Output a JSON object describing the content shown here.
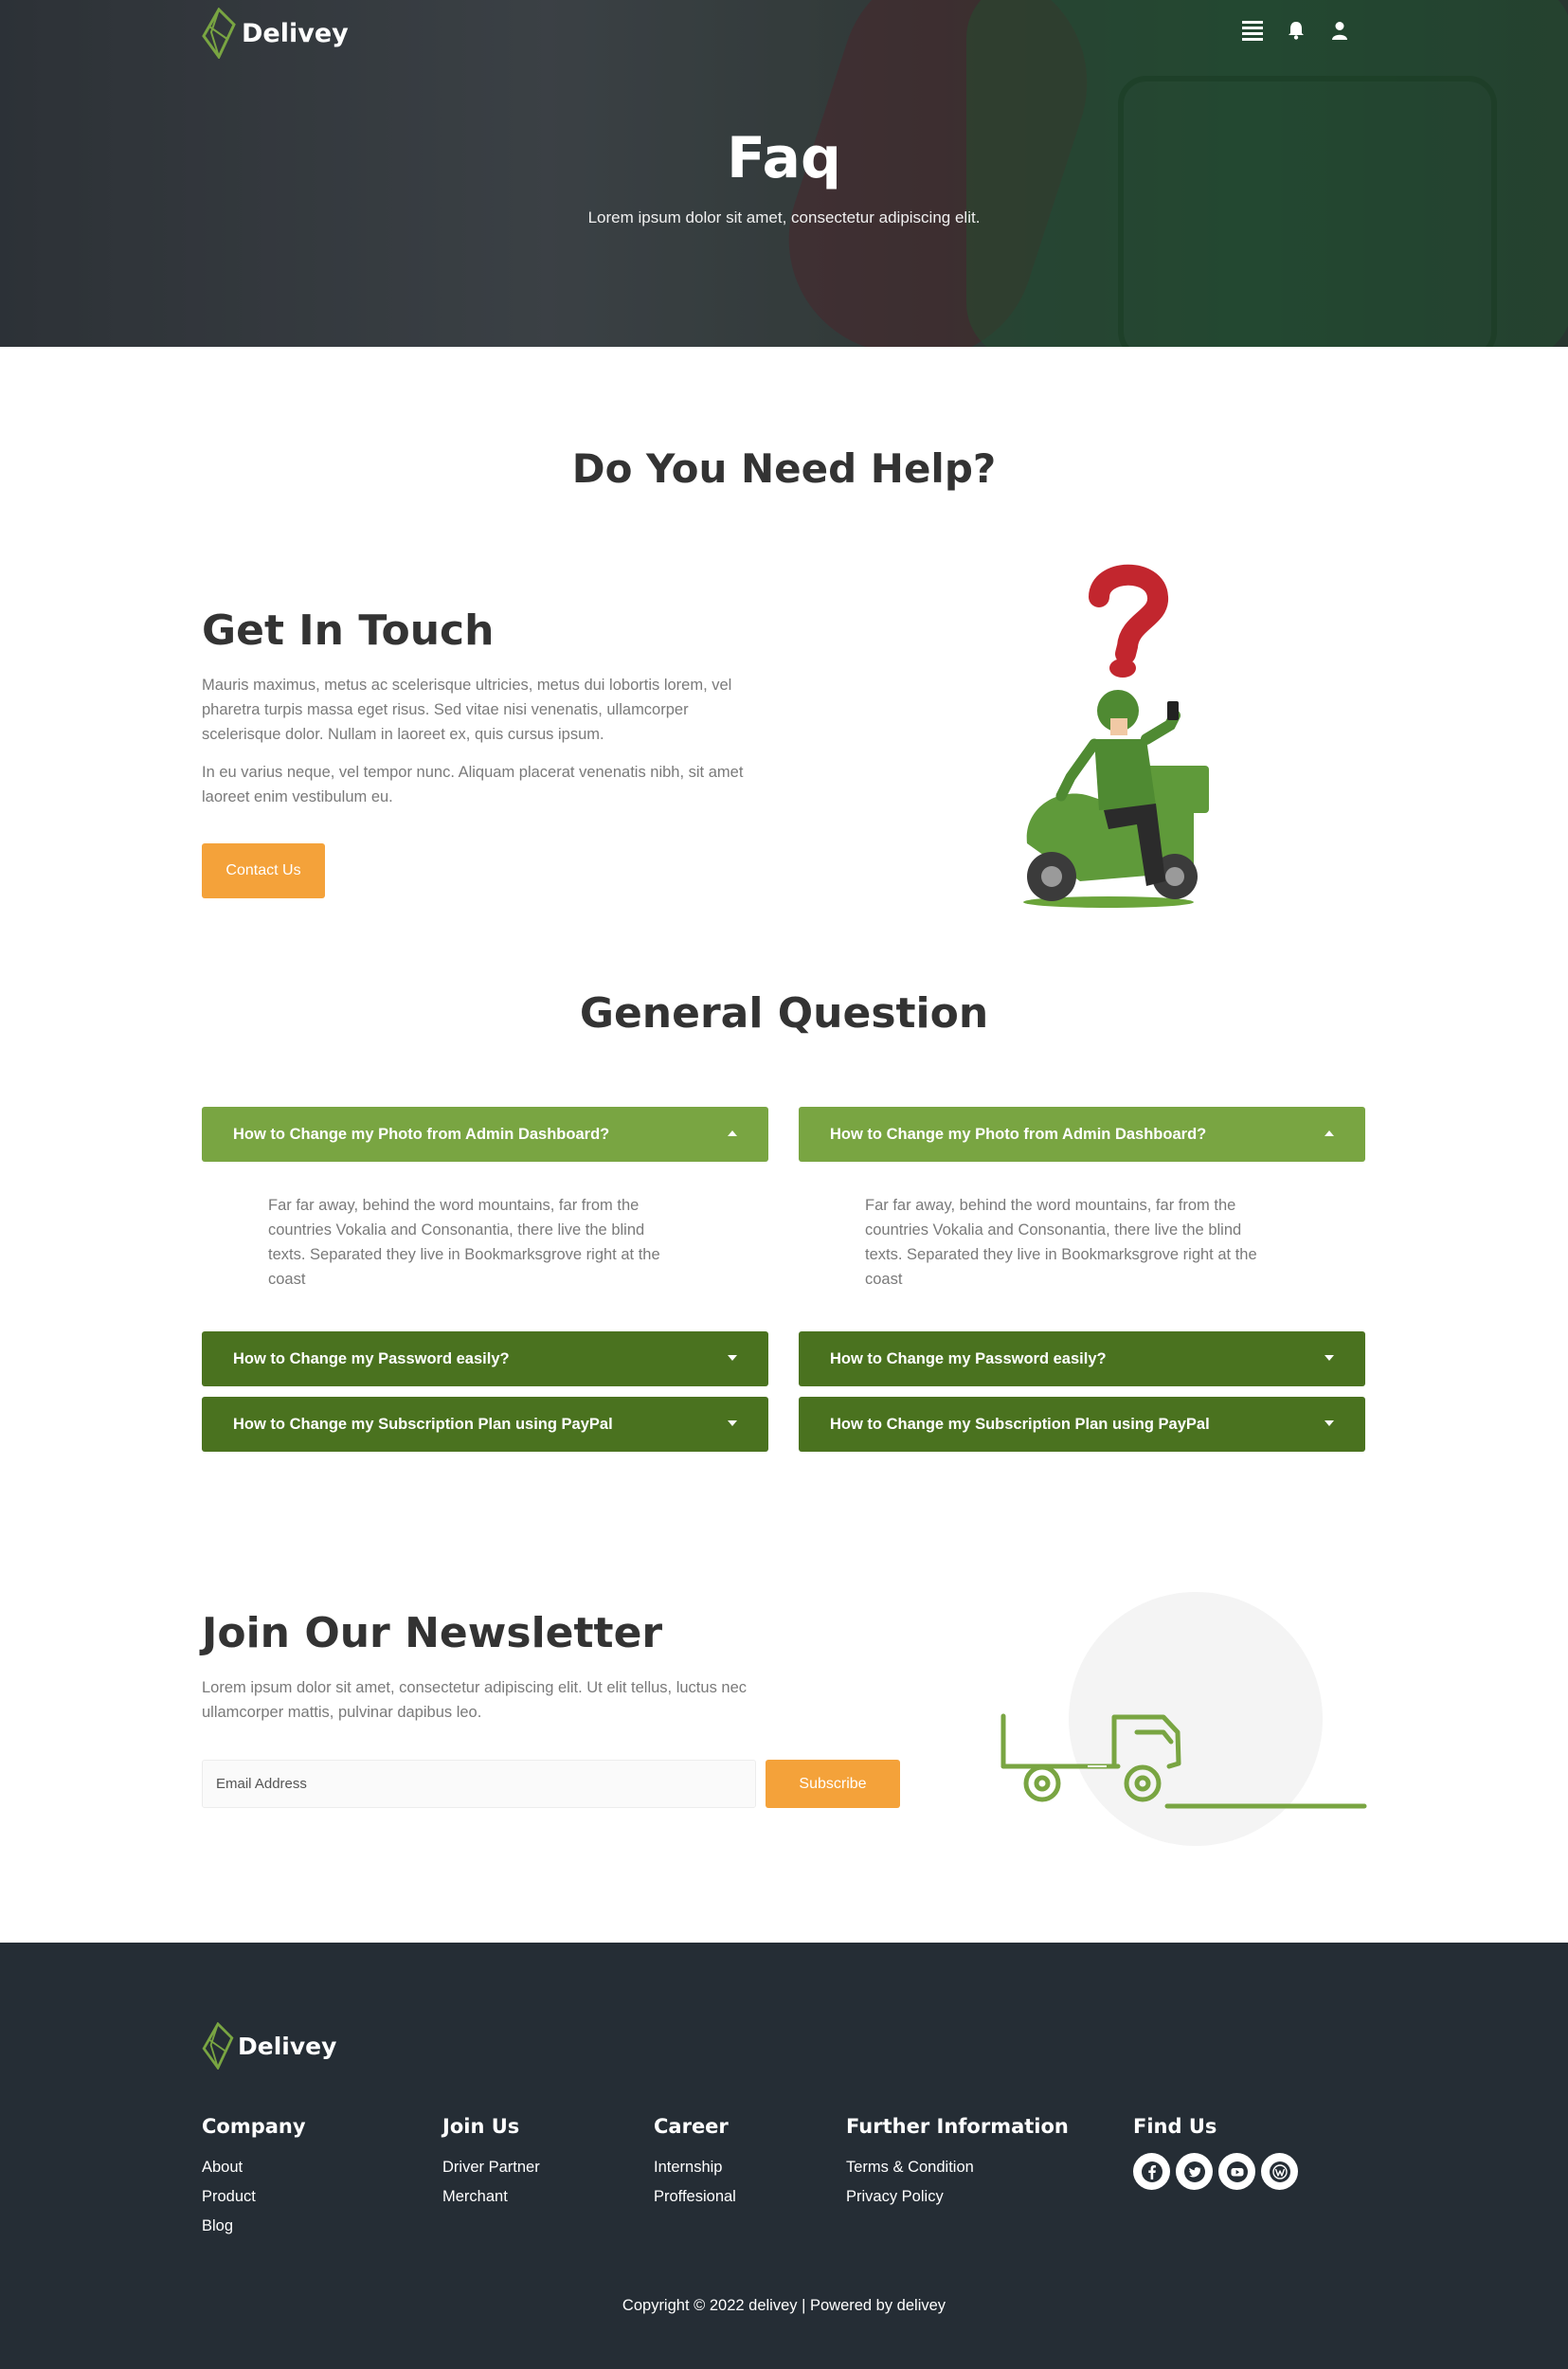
{
  "brand": {
    "name": "Delivey"
  },
  "header": {
    "icons": [
      "menu-icon",
      "bell-icon",
      "user-icon"
    ]
  },
  "hero": {
    "title": "Faq",
    "subtitle": "Lorem ipsum dolor sit amet, consectetur adipiscing elit."
  },
  "help": {
    "title": "Do You Need Help?",
    "get_in_touch": {
      "title": "Get In Touch",
      "paragraph1": "Mauris maximus, metus ac scelerisque ultricies, metus dui lobortis lorem, vel pharetra turpis massa eget risus. Sed vitae nisi venenatis, ullamcorper scelerisque dolor. Nullam in laoreet ex, quis cursus ipsum.",
      "paragraph2": "In eu varius neque, vel tempor nunc. Aliquam placerat venenatis nibh, sit amet laoreet enim vestibulum eu.",
      "button": "Contact Us"
    }
  },
  "general": {
    "title": "General Question",
    "left": {
      "q1": "How to Change my Photo from Admin Dashboard?",
      "a1": "Far far away, behind the word mountains, far from the countries Vokalia and Consonantia, there live the blind texts. Separated they live in Bookmarksgrove right at the coast",
      "q2": "How to Change my Password easily?",
      "q3": "How to Change my Subscription Plan using PayPal"
    },
    "right": {
      "q1": "How to Change my Photo from Admin Dashboard?",
      "a1": "Far far away, behind the word mountains, far from the countries Vokalia and Consonantia, there live the blind texts. Separated they live in Bookmarksgrove right at the coast",
      "q2": "How to Change my Password easily?",
      "q3": "How to Change my Subscription Plan using PayPal"
    }
  },
  "newsletter": {
    "title": "Join Our Newsletter",
    "text": "Lorem ipsum dolor sit amet, consectetur adipiscing elit. Ut elit tellus, luctus nec ullamcorper mattis, pulvinar dapibus leo.",
    "placeholder": "Email Address",
    "button": "Subscribe"
  },
  "footer": {
    "company": {
      "title": "Company",
      "links": [
        "About",
        "Product",
        "Blog"
      ]
    },
    "join": {
      "title": "Join Us",
      "links": [
        "Driver Partner",
        "Merchant"
      ]
    },
    "career": {
      "title": "Career",
      "links": [
        "Internship",
        "Proffesional"
      ]
    },
    "further": {
      "title": "Further Information",
      "links": [
        "Terms & Condition",
        "Privacy Policy"
      ]
    },
    "find": {
      "title": "Find Us",
      "icons": [
        "facebook-icon",
        "twitter-icon",
        "youtube-icon",
        "wordpress-icon"
      ]
    },
    "copyright": "Copyright © 2022 delivey | Powered by delivey"
  },
  "colors": {
    "accent_orange": "#f4a23a",
    "faq_open_green": "#79a542",
    "faq_closed_green": "#4a721f",
    "footer_bg": "#252d35"
  }
}
